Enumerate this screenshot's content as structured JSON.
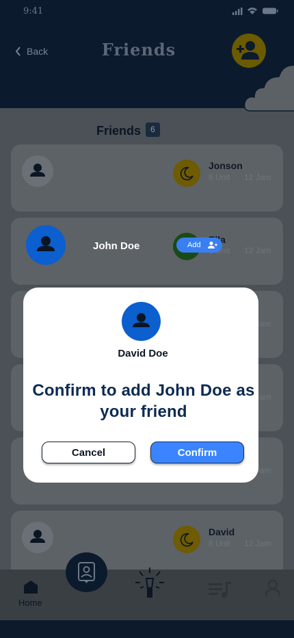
{
  "status_bar": {
    "time": "9:41"
  },
  "header": {
    "back_label": "Back",
    "title": "Friends"
  },
  "friends_list": {
    "title": "Friends",
    "count": "6"
  },
  "cards": [
    {
      "name": "Jonson",
      "units": "8 Unit",
      "date": "12 Jam"
    },
    {
      "name": "Ella",
      "units": "8 Unit",
      "date": "12 Jam"
    },
    {
      "date": "12 Jam"
    },
    {
      "date": "12 Jam"
    },
    {
      "date": "12 Jam"
    },
    {
      "name": "David",
      "units": "8 Unit",
      "date": "12 Jam"
    }
  ],
  "suggestion": {
    "name": "John Doe",
    "add_label": "Add"
  },
  "nav": {
    "home_label": "Home"
  },
  "modal": {
    "name": "David Doe",
    "message": "Confirm to add John Doe as your friend",
    "cancel_label": "Cancel",
    "confirm_label": "Confirm"
  },
  "colors": {
    "primary": "#0b5fcf",
    "confirm": "#3a85ff",
    "navy": "#0b1a2d"
  }
}
